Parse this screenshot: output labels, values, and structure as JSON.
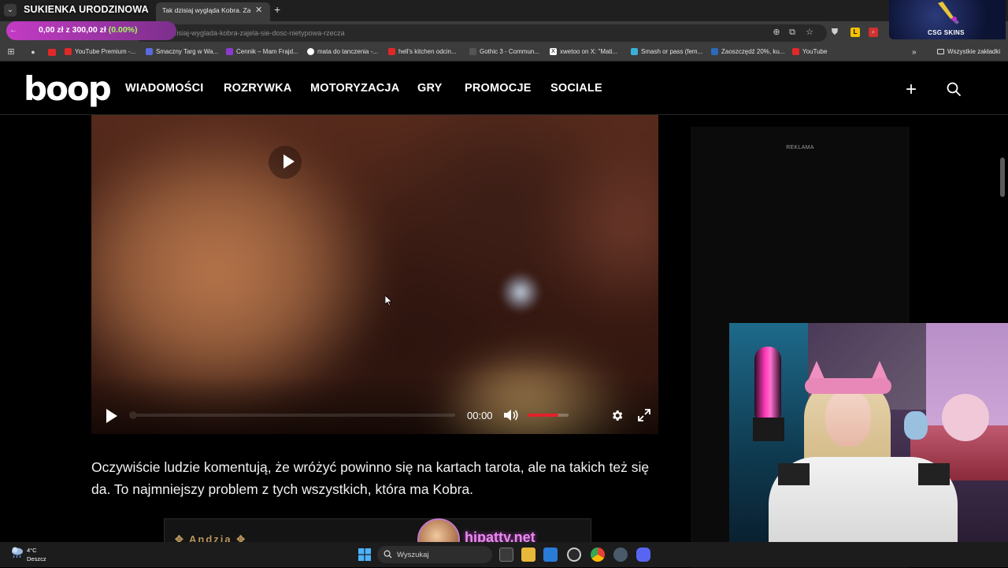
{
  "browser": {
    "active_tab_title": "Tak dzisiaj wygląda Kobra. Zajęła...",
    "url": "dzisiaj-wyglada-kobra-zajela-sie-dosc-nietypowa-rzecza",
    "bookmarks": [
      "YouTube Premium -...",
      "Smaczny Targ w Wa...",
      "Cennik – Mam Frajd...",
      "mata do tanczenia -...",
      "hell's kitchen odcin...",
      "Gothic 3 - Commun...",
      "xwetoo on X: \"Mati...",
      "Smash or pass (fem...",
      "Zaoszczędź 20%, ku...",
      "YouTube"
    ],
    "all_bookmarks": "Wszystkie zakładki"
  },
  "stream": {
    "overlay_title": "SUKIENKA URODZINOWA",
    "goal_current": "0,00 zł",
    "goal_sep": "z",
    "goal_target": "300,00 zł",
    "goal_percent": "(0.00%)",
    "sponsor": "CSG SKINS",
    "streamer_site": "hipatty.net"
  },
  "site": {
    "logo": "boop",
    "nav": [
      "WIADOMOŚCI",
      "ROZRYWKA",
      "MOTORYZACJA",
      "GRY",
      "PROMOCJE",
      "SOCIALE"
    ],
    "ad_label": "REKLAMA"
  },
  "video": {
    "time": "00:00",
    "progress": 0,
    "volume": 0.75
  },
  "article": {
    "paragraph": "Oczywiście ludzie komentują, że wróżyć powinno się na kartach tarota, ale na takich też się da. To najmniejszy problem z tych wszystkich, która ma Kobra.",
    "embed_title": "Andzia"
  },
  "taskbar": {
    "temperature": "4°C",
    "weather": "Deszcz",
    "search_placeholder": "Wyszukaj"
  },
  "colors": {
    "accent_red": "#e4202a",
    "goal_green": "#9eff5a",
    "hipatty_pink": "#e98bf0"
  }
}
